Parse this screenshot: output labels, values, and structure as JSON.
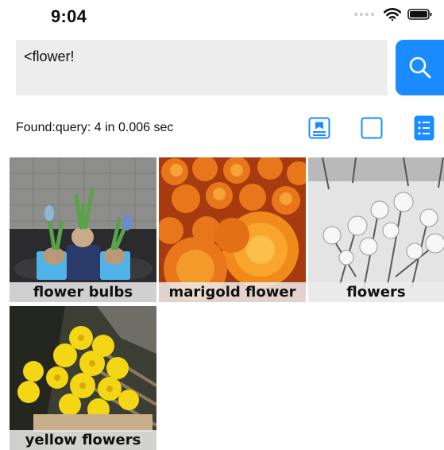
{
  "status_bar": {
    "time": "9:04"
  },
  "search": {
    "value": "<flower!"
  },
  "results": {
    "found_text": "Found:query: 4 in 0.006 sec"
  },
  "view_modes": [
    {
      "icon": "card-view-icon",
      "selected": false
    },
    {
      "icon": "square-view-icon",
      "selected": false
    },
    {
      "icon": "list-view-icon",
      "selected": true
    }
  ],
  "colors": {
    "accent": "#1a8cff",
    "field_bg": "#ededed"
  },
  "images": [
    {
      "caption": "flower bulbs"
    },
    {
      "caption": "marigold flower"
    },
    {
      "caption": "flowers"
    },
    {
      "caption": "yellow flowers"
    }
  ]
}
